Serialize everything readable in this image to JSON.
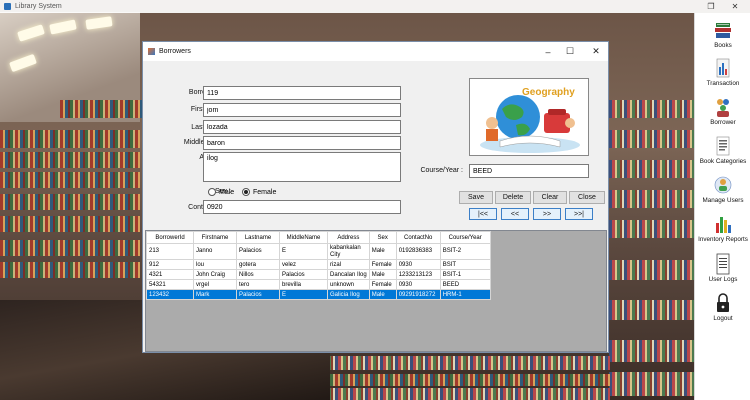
{
  "app": {
    "title": "Library System"
  },
  "window": {
    "title": "Borrowers"
  },
  "form": {
    "borrower_id_label": "Borrower Id :",
    "borrower_id": "119",
    "first_name_label": "First Name :",
    "first_name": "jom",
    "last_name_label": "Last Name :",
    "last_name": "lozada",
    "middle_name_label": "Middle Name :",
    "middle_name": "baron",
    "address_label": "Address :",
    "address": "ilog",
    "sex_label": "Sex :",
    "sex_options": [
      "Male",
      "Female"
    ],
    "sex_selected": "Female",
    "contact_label": "Contact No. :",
    "contact": "0920",
    "course_label": "Course/Year :",
    "course": "BEED"
  },
  "buttons": {
    "save": "Save",
    "delete": "Delete",
    "clear": "Clear",
    "close": "Close"
  },
  "nav": {
    "first": "|<<",
    "prev": "<<",
    "next": ">>",
    "last": ">>|"
  },
  "photo": {
    "text": "Geography"
  },
  "table": {
    "columns": [
      "BorrowerId",
      "Firstname",
      "Lastname",
      "MiddleName",
      "Address",
      "Sex",
      "ContactNo",
      "Course/Year"
    ],
    "rows": [
      [
        "213",
        "Janno",
        "Palacios",
        "E",
        "kabankalan City",
        "Male",
        "0192836383",
        "BSIT-2"
      ],
      [
        "912",
        "lou",
        "gotera",
        "velez",
        "rizal",
        "Female",
        "0930",
        "BSIT"
      ],
      [
        "4321",
        "John Craig",
        "Nillos",
        "Palacios",
        "Dancalan Ilog",
        "Male",
        "1233213123",
        "BSIT-1"
      ],
      [
        "54321",
        "vrgel",
        "tero",
        "brevilla",
        "unknown",
        "Female",
        "0930",
        "BEED"
      ],
      [
        "123432",
        "Mark",
        "Palacios",
        "E",
        "Galicia Ilog",
        "Male",
        "09291918272",
        "HRM-1"
      ]
    ],
    "selected_row": 4
  },
  "sidebar": {
    "items": [
      {
        "label": "Books",
        "icon": "books-icon"
      },
      {
        "label": "Transaction",
        "icon": "transaction-icon"
      },
      {
        "label": "Borrower",
        "icon": "borrower-icon"
      },
      {
        "label": "Book Categories",
        "icon": "book-categories-icon"
      },
      {
        "label": "Manage Users",
        "icon": "manage-users-icon"
      },
      {
        "label": "Inventory Reports",
        "icon": "inventory-reports-icon"
      },
      {
        "label": "User Logs",
        "icon": "user-logs-icon"
      },
      {
        "label": "Logout",
        "icon": "logout-icon"
      }
    ]
  },
  "colors": {
    "selection": "#0078d7",
    "window_border": "#7a8ea8"
  }
}
